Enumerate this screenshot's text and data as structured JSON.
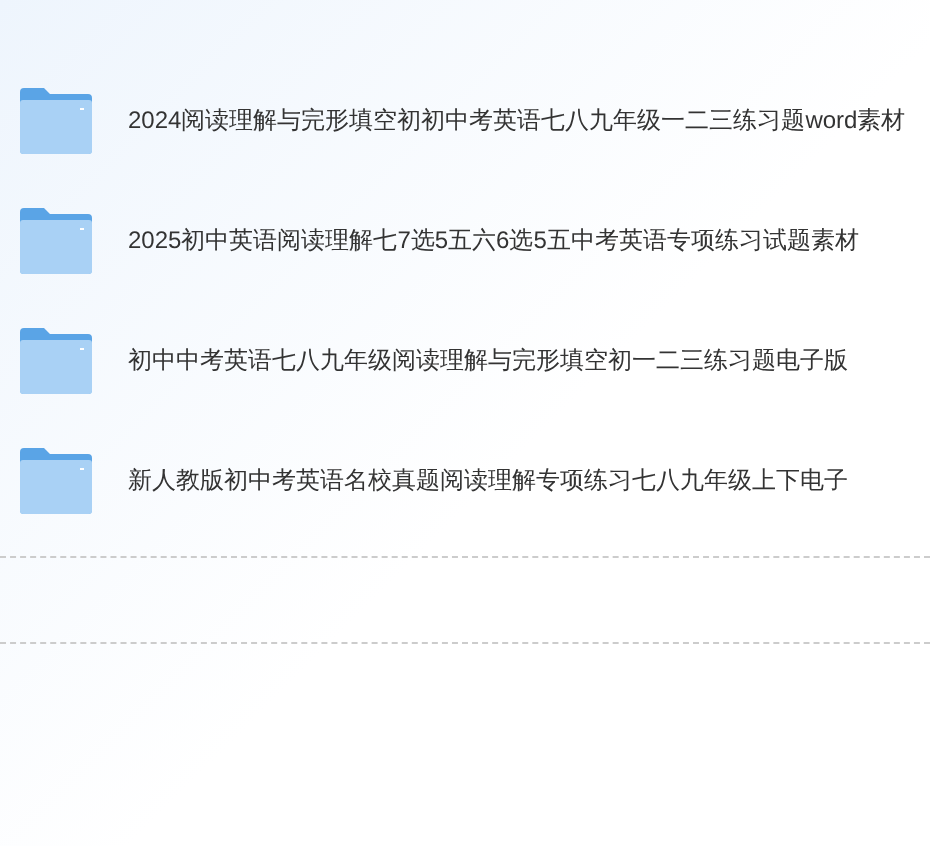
{
  "files": [
    {
      "name": "2024阅读理解与完形填空初初中考英语七八九年级一二三练习题word素材"
    },
    {
      "name": "2025初中英语阅读理解七7选5五六6选5五中考英语专项练习试题素材"
    },
    {
      "name": "初中中考英语七八九年级阅读理解与完形填空初一二三练习题电子版"
    },
    {
      "name": "新人教版初中考英语名校真题阅读理解专项练习七八九年级上下电子"
    }
  ]
}
